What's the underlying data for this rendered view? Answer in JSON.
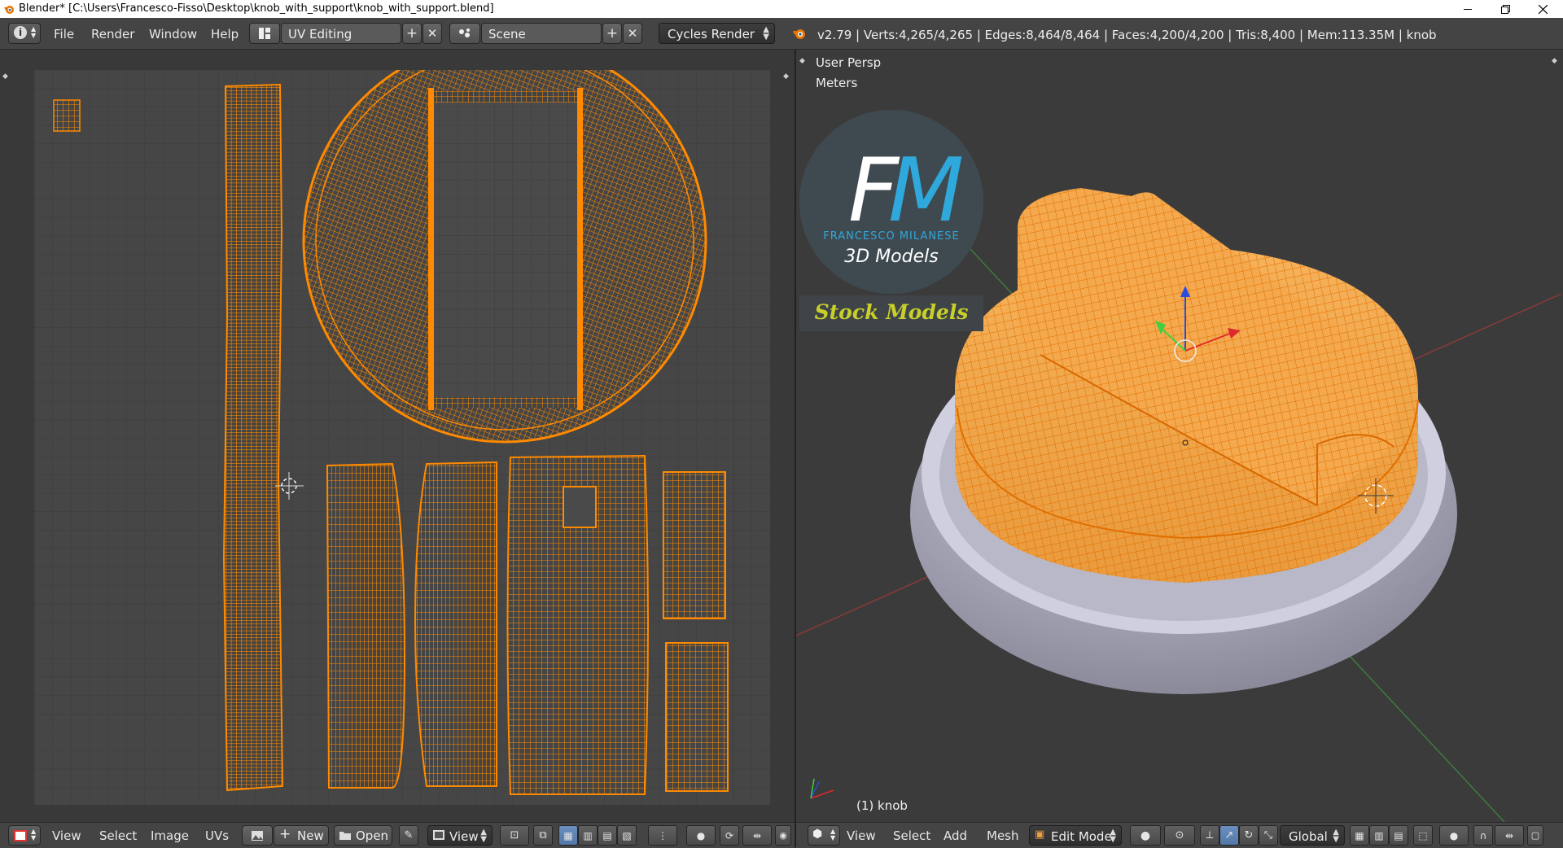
{
  "window": {
    "title": "Blender* [C:\\Users\\Francesco-Fisso\\Desktop\\knob_with_support\\knob_with_support.blend]",
    "controls": [
      "minimize-icon",
      "restore-icon",
      "close-icon"
    ]
  },
  "info_header": {
    "menus": [
      "File",
      "Render",
      "Window",
      "Help"
    ],
    "screen_layout": "UV Editing",
    "scene": "Scene",
    "render_engine": "Cycles Render",
    "stats": "v2.79 | Verts:4,265/4,265 | Edges:8,464/8,464 | Faces:4,200/4,200 | Tris:8,400 | Mem:113.35M | knob"
  },
  "uv_editor": {
    "footer_menus": [
      "View",
      "Select",
      "Image",
      "UVs"
    ],
    "new_label": "New",
    "open_label": "Open",
    "view_label": "View"
  },
  "viewport": {
    "view_name": "User Persp",
    "units": "Meters",
    "object_label": "(1) knob",
    "footer_menus": [
      "View",
      "Select",
      "Add",
      "Mesh"
    ],
    "mode": "Edit Mode",
    "orientation": "Global"
  },
  "logo": {
    "monogram": "FM",
    "name": "FRANCESCO MILANESE",
    "tagline": "3D Models",
    "banner": "Stock Models"
  },
  "colors": {
    "uv_wire": "#ff8a00",
    "grid_bg": "#464646",
    "panel_bg": "#393939",
    "header_bg": "#444444",
    "active_blue": "#5377a8"
  }
}
